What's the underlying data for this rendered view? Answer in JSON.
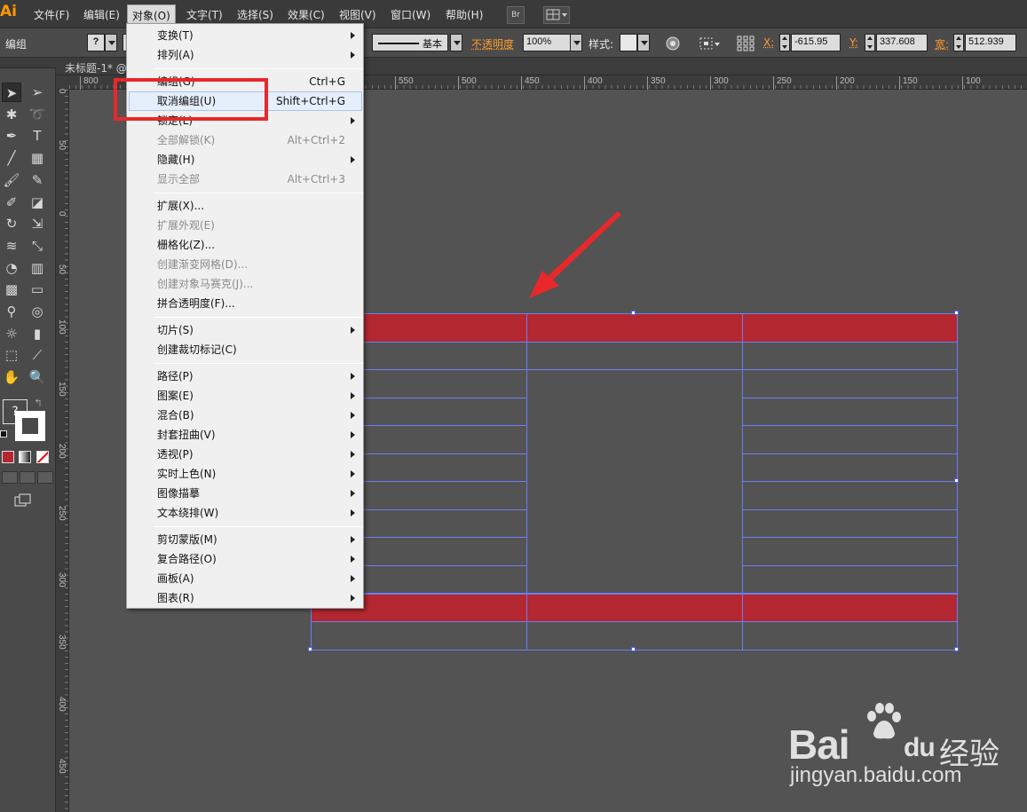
{
  "app": {
    "logo_text": "Ai",
    "colors": {
      "accent": "#ff9a00",
      "selection": "#6a7ef5",
      "fill": "#b32730",
      "annotation": "#e8282b"
    }
  },
  "menubar": {
    "items": [
      "文件(F)",
      "编辑(E)",
      "对象(O)",
      "文字(T)",
      "选择(S)",
      "效果(C)",
      "视图(V)",
      "窗口(W)",
      "帮助(H)"
    ],
    "active_index": 2,
    "bridge_label": "Br"
  },
  "controlbar": {
    "selection_label": "编组",
    "fill_glyph": "?",
    "stroke_style_label": "基本",
    "opacity_label": "不透明度",
    "opacity_value": "100%",
    "style_label": "样式:",
    "x_label": "X:",
    "x_value": "-615.95",
    "y_label": "Y:",
    "y_value": "337.608",
    "w_label": "宽:",
    "w_value": "512.939"
  },
  "document": {
    "tab_label": "未标题-1* @"
  },
  "rulers": {
    "horizontal": [
      "800",
      "550",
      "500",
      "450",
      "400",
      "350",
      "300",
      "250",
      "200",
      "150",
      "100"
    ],
    "vertical": [
      "0",
      "50",
      "0",
      "50",
      "100",
      "150",
      "200",
      "250",
      "300",
      "350",
      "400",
      "450"
    ]
  },
  "toolbox": {
    "fill_glyph": "?",
    "icons": [
      "selection-tool",
      "direct-selection-tool",
      "magic-wand-tool",
      "lasso-tool",
      "pen-tool",
      "type-tool",
      "line-tool",
      "rectangle-tool",
      "paintbrush-tool",
      "pencil-tool",
      "blob-brush-tool",
      "eraser-tool",
      "rotate-tool",
      "scale-tool",
      "warp-tool",
      "free-transform-tool",
      "shape-builder-tool",
      "perspective-grid-tool",
      "mesh-tool",
      "gradient-tool",
      "eyedropper-tool",
      "blend-tool",
      "symbol-sprayer-tool",
      "column-graph-tool",
      "artboard-tool",
      "slice-tool",
      "hand-tool",
      "zoom-tool"
    ]
  },
  "dropdown": {
    "items": [
      {
        "label": "变换(T)",
        "shortcut": "",
        "submenu": true,
        "disabled": false
      },
      {
        "label": "排列(A)",
        "shortcut": "",
        "submenu": true,
        "disabled": false
      },
      {
        "label": "编组(G)",
        "shortcut": "Ctrl+G",
        "submenu": false,
        "disabled": false
      },
      {
        "label": "取消编组(U)",
        "shortcut": "Shift+Ctrl+G",
        "submenu": false,
        "disabled": false,
        "highlighted": true
      },
      {
        "label": "锁定(L)",
        "shortcut": "",
        "submenu": true,
        "disabled": false
      },
      {
        "label": "全部解锁(K)",
        "shortcut": "Alt+Ctrl+2",
        "submenu": false,
        "disabled": true
      },
      {
        "label": "隐藏(H)",
        "shortcut": "",
        "submenu": true,
        "disabled": false
      },
      {
        "label": "显示全部",
        "shortcut": "Alt+Ctrl+3",
        "submenu": false,
        "disabled": true
      },
      {
        "label": "扩展(X)...",
        "shortcut": "",
        "submenu": false,
        "disabled": false
      },
      {
        "label": "扩展外观(E)",
        "shortcut": "",
        "submenu": false,
        "disabled": true
      },
      {
        "label": "栅格化(Z)...",
        "shortcut": "",
        "submenu": false,
        "disabled": false
      },
      {
        "label": "创建渐变网格(D)...",
        "shortcut": "",
        "submenu": false,
        "disabled": true
      },
      {
        "label": "创建对象马赛克(J)...",
        "shortcut": "",
        "submenu": false,
        "disabled": true
      },
      {
        "label": "拼合透明度(F)...",
        "shortcut": "",
        "submenu": false,
        "disabled": false
      },
      {
        "label": "切片(S)",
        "shortcut": "",
        "submenu": true,
        "disabled": false
      },
      {
        "label": "创建裁切标记(C)",
        "shortcut": "",
        "submenu": false,
        "disabled": false
      },
      {
        "label": "路径(P)",
        "shortcut": "",
        "submenu": true,
        "disabled": false
      },
      {
        "label": "图案(E)",
        "shortcut": "",
        "submenu": true,
        "disabled": false
      },
      {
        "label": "混合(B)",
        "shortcut": "",
        "submenu": true,
        "disabled": false
      },
      {
        "label": "封套扭曲(V)",
        "shortcut": "",
        "submenu": true,
        "disabled": false
      },
      {
        "label": "透视(P)",
        "shortcut": "",
        "submenu": true,
        "disabled": false
      },
      {
        "label": "实时上色(N)",
        "shortcut": "",
        "submenu": true,
        "disabled": false
      },
      {
        "label": "图像描摹",
        "shortcut": "",
        "submenu": true,
        "disabled": false
      },
      {
        "label": "文本绕排(W)",
        "shortcut": "",
        "submenu": true,
        "disabled": false
      },
      {
        "label": "剪切蒙版(M)",
        "shortcut": "",
        "submenu": true,
        "disabled": false
      },
      {
        "label": "复合路径(O)",
        "shortcut": "",
        "submenu": true,
        "disabled": false
      },
      {
        "label": "画板(A)",
        "shortcut": "",
        "submenu": true,
        "disabled": false
      },
      {
        "label": "图表(R)",
        "shortcut": "",
        "submenu": true,
        "disabled": false
      }
    ]
  },
  "artwork": {
    "rows": 12,
    "cols": 3,
    "red_rows": [
      0,
      10
    ]
  },
  "watermark": {
    "brand_left": "Bai",
    "brand_right": "du",
    "brand_cn": "经验",
    "url": "jingyan.baidu.com"
  }
}
